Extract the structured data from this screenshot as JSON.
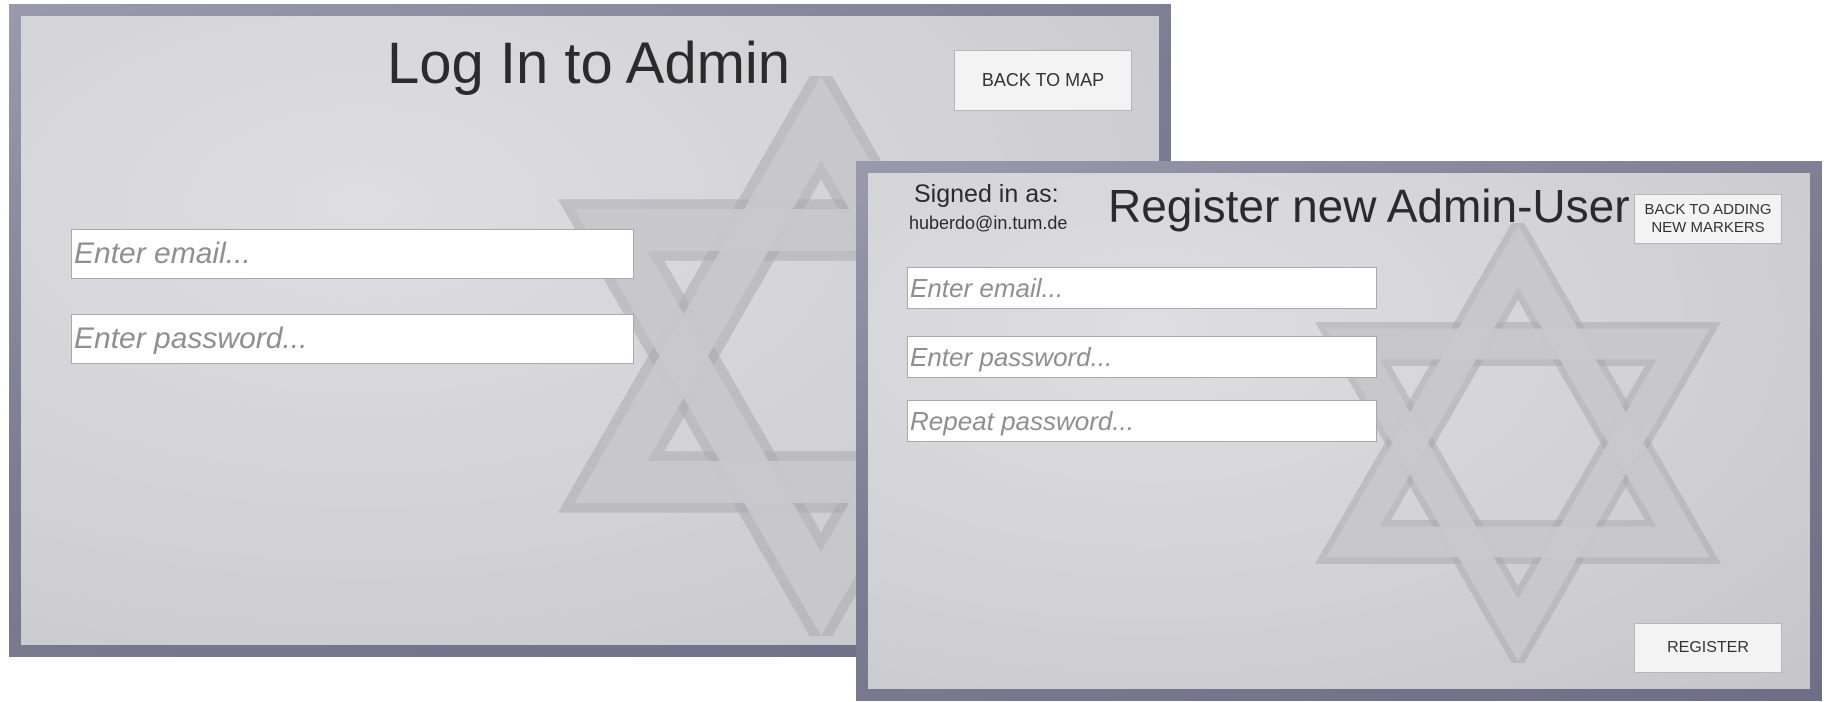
{
  "login_screen": {
    "title": "Log In to Admin",
    "back_button": "BACK TO MAP",
    "email_placeholder": "Enter email...",
    "password_placeholder": "Enter password..."
  },
  "register_screen": {
    "signed_in_label": "Signed in as:",
    "signed_in_email": "huberdo@in.tum.de",
    "title": "Register new Admin-User",
    "back_button": "BACK TO ADDING NEW MARKERS",
    "email_placeholder": "Enter email...",
    "password_placeholder": "Enter password...",
    "repeat_password_placeholder": "Repeat password...",
    "register_button": "REGISTER"
  },
  "background_image": {
    "subject": "star-of-david-relief-icon"
  },
  "colors": {
    "frame": "#7c7c92",
    "panel": "#d6d6da",
    "button_bg": "#f3f3f3",
    "title_text": "#2b2b2b",
    "placeholder_text": "#8f8f8f"
  }
}
